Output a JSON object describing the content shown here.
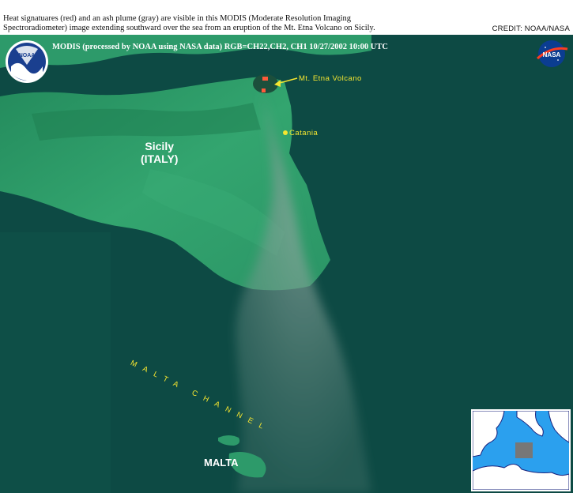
{
  "caption": {
    "line1": "Heat signatuares (red) and an ash plume (gray) are visible in this MODIS (Moderate Resolution Imaging",
    "line2": "Spectroradiometer) image  extending southward over the sea from an eruption of the Mt. Etna Volcano on Sicily."
  },
  "credit": "CREDIT: NOAA/NASA",
  "header_line": "MODIS  (processed by NOAA using NASA data)  RGB=CH22,CH2, CH1  10/27/2002  10:00 UTC",
  "logos": {
    "noaa": "NOAA",
    "nasa": "NASA"
  },
  "labels": {
    "sicily_line1": "Sicily",
    "sicily_line2": "(ITALY)",
    "etna": "Mt. Etna Volcano",
    "catania": "Catania",
    "malta_channel": "MALTA CHANNEL",
    "malta": "MALTA"
  },
  "colors": {
    "sea": "#0d4a44",
    "land": "#2c9a6a",
    "plume": "#7a9a90",
    "label_yellow": "#f6e630",
    "hotspot": "#ff5a3a",
    "inset_sea": "#2ba0ee",
    "inset_land": "#ffffff"
  }
}
